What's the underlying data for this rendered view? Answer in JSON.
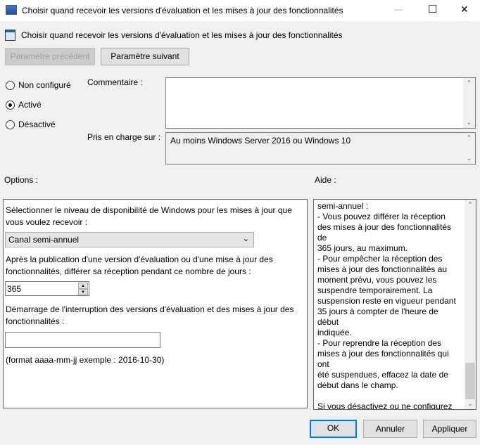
{
  "window": {
    "title": "Choisir quand recevoir les versions d'évaluation et les mises à jour des fonctionnalités",
    "minimize": "—",
    "maximize": "☐",
    "close": "✕"
  },
  "header": {
    "title": "Choisir quand recevoir les versions d'évaluation et les mises à jour des fonctionnalités"
  },
  "nav": {
    "previous": "Paramètre précédent",
    "next": "Paramètre suivant"
  },
  "state": {
    "options": [
      {
        "label": "Non configuré",
        "checked": false
      },
      {
        "label": "Activé",
        "checked": true
      },
      {
        "label": "Désactivé",
        "checked": false
      }
    ]
  },
  "comment": {
    "label": "Commentaire :",
    "value": ""
  },
  "supported": {
    "label": "Pris en charge sur :",
    "value": "Au moins Windows Server 2016 ou Windows 10"
  },
  "options": {
    "label": "Options :",
    "level_text": "Sélectionner le niveau de disponibilité de Windows pour les mises à jour que vous voulez recevoir :",
    "channel": "Canal semi-annuel",
    "defer_text": "Après la publication d'une version d'évaluation ou d'une mise à jour des fonctionnalités, différer sa réception pendant ce nombre de jours :",
    "defer_days": "365",
    "pause_text": "Démarrage de l'interruption des versions d'évaluation et des mises à jour des fonctionnalités :",
    "pause_date": "",
    "format_hint": "(format aaaa-mm-jj exemple : 2016-10-30)"
  },
  "help": {
    "label": "Aide :",
    "text": "semi-annuel :\n    - Vous pouvez différer la réception\ndes mises à jour des fonctionnalités de\n365 jours, au maximum.\n    - Pour empêcher la réception des\nmises à jour des fonctionnalités au\nmoment prévu, vous pouvez les\nsuspendre temporairement. La\nsuspension reste en vigueur pendant\n35 jours à compter de l'heure de début\nindiquée.\n    - Pour reprendre la réception des\nmises à jour des fonctionnalités qui ont\nété suspendues, effacez la date de\ndébut dans le champ.\n\nSi vous désactivez ou ne configurez pas\ncette stratégie, Windows Update ne\nchange pas de comportement."
  },
  "footer": {
    "ok": "OK",
    "cancel": "Annuler",
    "apply": "Appliquer"
  }
}
